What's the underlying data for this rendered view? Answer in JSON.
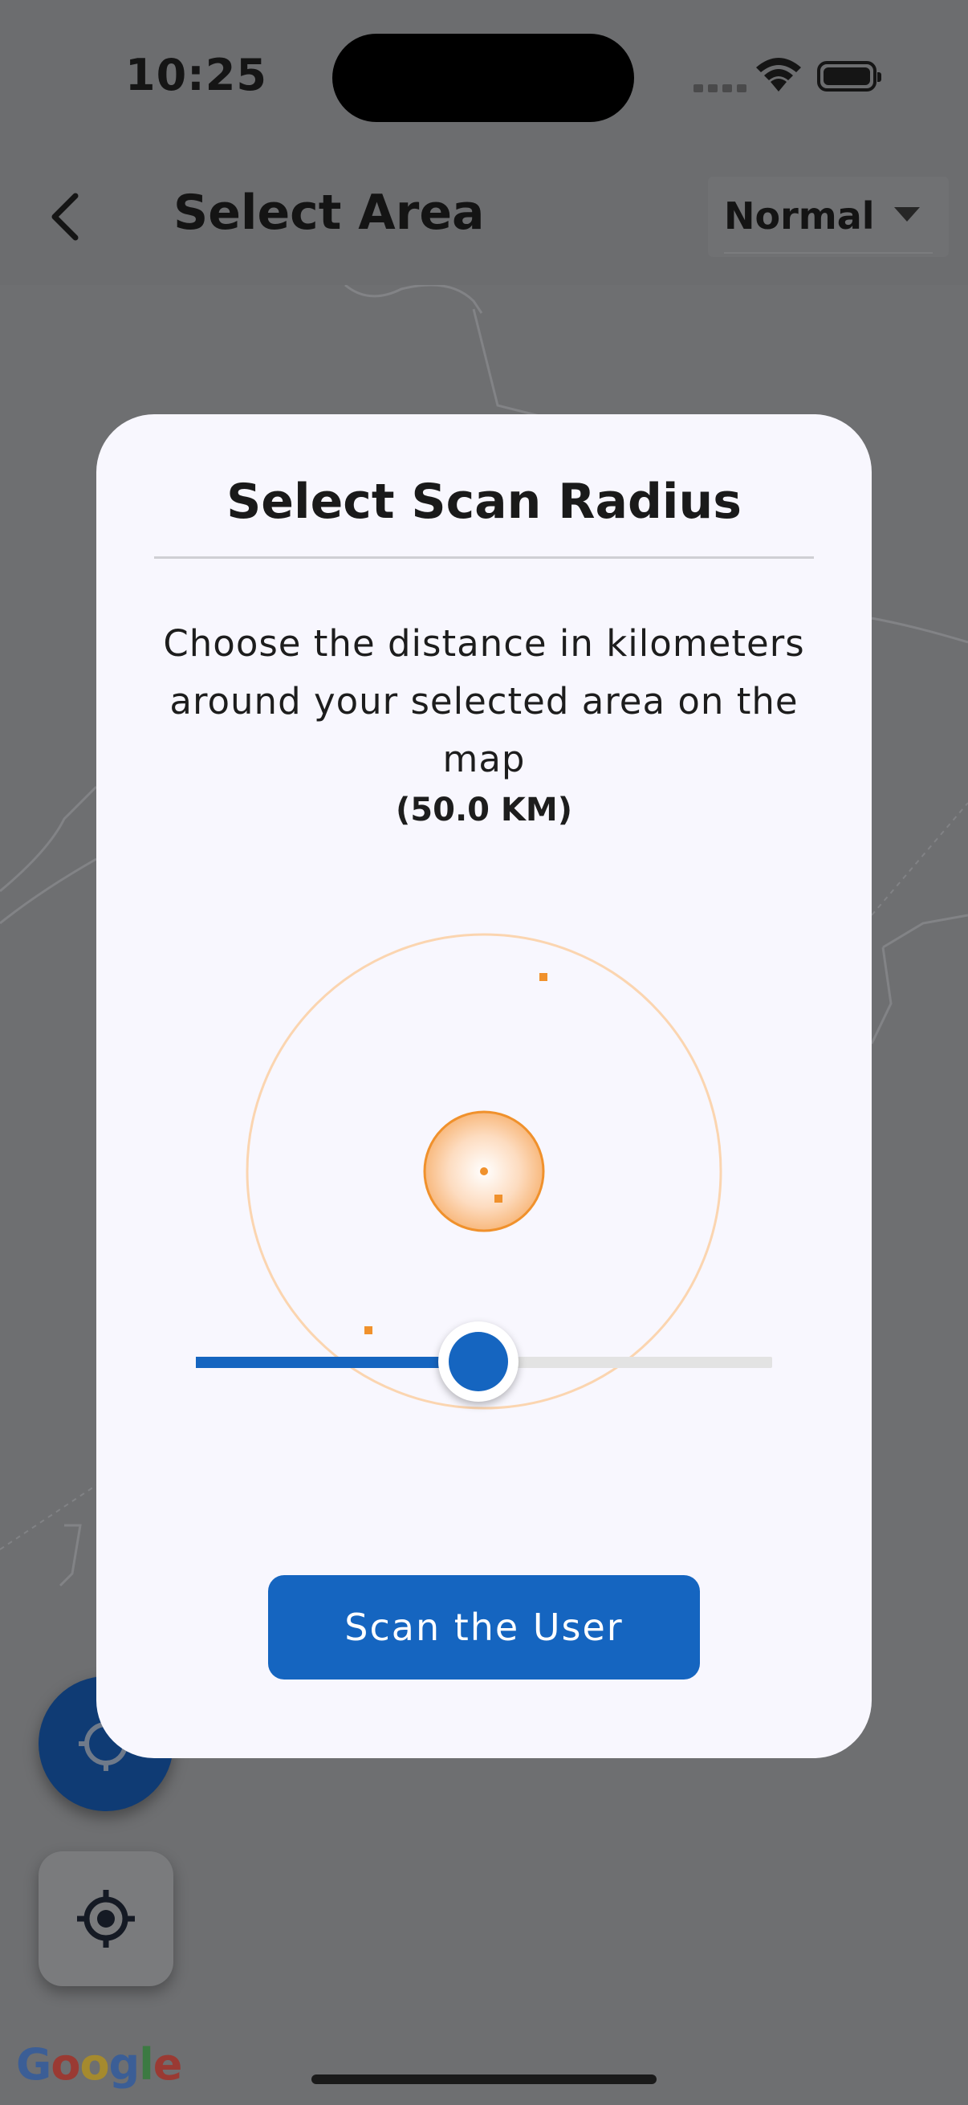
{
  "status_bar": {
    "time": "10:25"
  },
  "app_bar": {
    "back_icon": "chevron-left-icon",
    "title": "Select Area",
    "map_type_selected": "Normal",
    "map_type_caret_icon": "caret-down-icon"
  },
  "dialog": {
    "title": "Select Scan Radius",
    "description": "Choose the distance in kilometers around your selected area on the map",
    "value_label": "(50.0 KM)",
    "slider": {
      "value_km": 50.0,
      "fraction": 0.49,
      "active_color": "#1565c0",
      "inactive_color": "#e3e3e3"
    },
    "radar": {
      "accent_color": "#f0912c",
      "ring_color": "#fbd5b0",
      "icon": "radar-icon"
    },
    "scan_button_label": "Scan the User"
  },
  "map_controls": {
    "location_button_icon": "crosshair-icon",
    "center_button_icon": "my-location-icon"
  },
  "google_logo": "Google",
  "colors": {
    "primary": "#1565c0",
    "dialog_bg": "#f8f7fe",
    "scrim_map": "#6e6f71"
  }
}
